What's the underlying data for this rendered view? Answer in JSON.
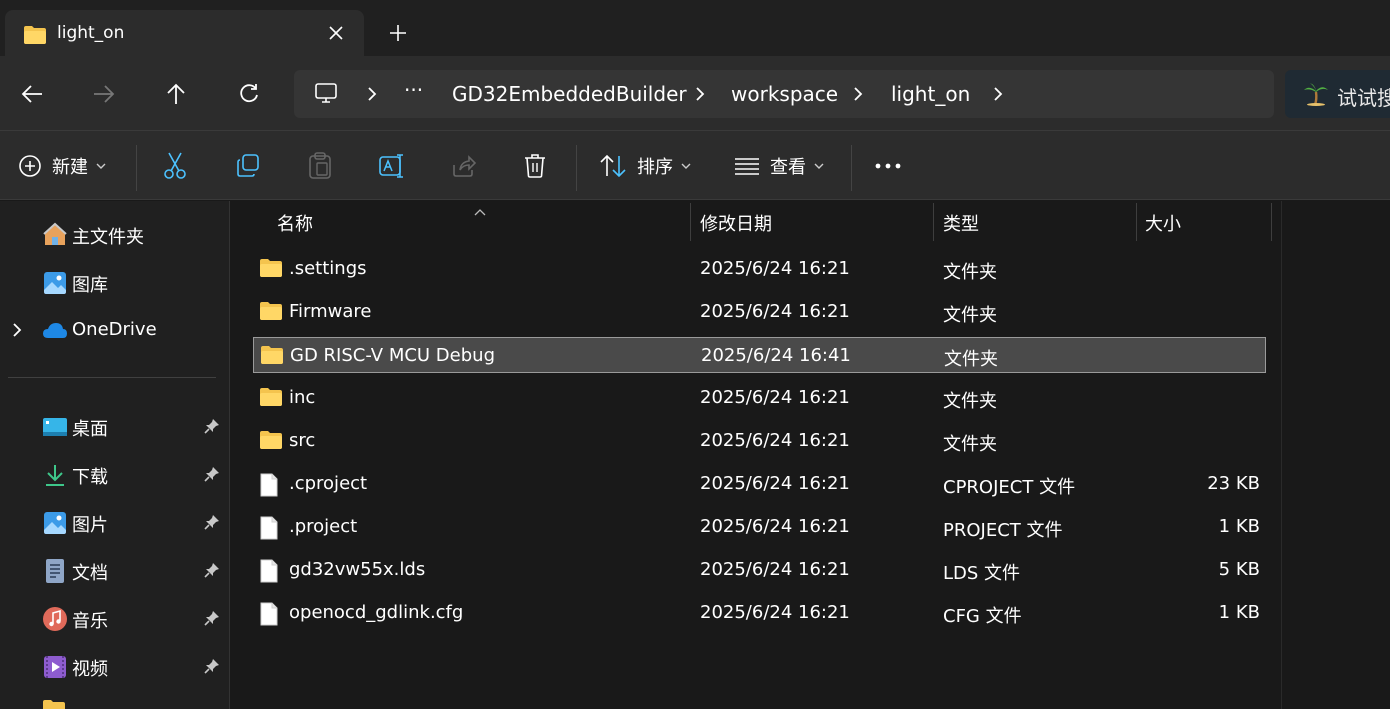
{
  "window": {
    "tab_title": "light_on"
  },
  "breadcrumb": {
    "overflow": "···",
    "items": [
      "GD32EmbeddedBuilder",
      "workspace",
      "light_on"
    ]
  },
  "search": {
    "placeholder": "试试搜"
  },
  "toolbar": {
    "new_label": "新建",
    "sort_label": "排序",
    "view_label": "查看",
    "more_label": "···"
  },
  "sidebar": {
    "items": [
      {
        "label": "主文件夹",
        "icon": "home-icon"
      },
      {
        "label": "图库",
        "icon": "gallery-icon"
      },
      {
        "label": "OneDrive",
        "icon": "cloud-icon"
      }
    ],
    "pinned": [
      {
        "label": "桌面",
        "icon": "desktop-icon"
      },
      {
        "label": "下载",
        "icon": "download-icon"
      },
      {
        "label": "图片",
        "icon": "pictures-icon"
      },
      {
        "label": "文档",
        "icon": "documents-icon"
      },
      {
        "label": "音乐",
        "icon": "music-icon"
      },
      {
        "label": "视频",
        "icon": "videos-icon"
      }
    ]
  },
  "columns": {
    "name": "名称",
    "date": "修改日期",
    "type": "类型",
    "size": "大小"
  },
  "files": [
    {
      "name": ".settings",
      "date": "2025/6/24 16:21",
      "type": "文件夹",
      "size": "",
      "kind": "folder"
    },
    {
      "name": "Firmware",
      "date": "2025/6/24 16:21",
      "type": "文件夹",
      "size": "",
      "kind": "folder"
    },
    {
      "name": "GD RISC-V MCU Debug",
      "date": "2025/6/24 16:41",
      "type": "文件夹",
      "size": "",
      "kind": "folder",
      "selected": true
    },
    {
      "name": "inc",
      "date": "2025/6/24 16:21",
      "type": "文件夹",
      "size": "",
      "kind": "folder"
    },
    {
      "name": "src",
      "date": "2025/6/24 16:21",
      "type": "文件夹",
      "size": "",
      "kind": "folder"
    },
    {
      "name": ".cproject",
      "date": "2025/6/24 16:21",
      "type": "CPROJECT 文件",
      "size": "23 KB",
      "kind": "file"
    },
    {
      "name": ".project",
      "date": "2025/6/24 16:21",
      "type": "PROJECT 文件",
      "size": "1 KB",
      "kind": "file"
    },
    {
      "name": "gd32vw55x.lds",
      "date": "2025/6/24 16:21",
      "type": "LDS 文件",
      "size": "5 KB",
      "kind": "file"
    },
    {
      "name": "openocd_gdlink.cfg",
      "date": "2025/6/24 16:21",
      "type": "CFG 文件",
      "size": "1 KB",
      "kind": "file"
    }
  ],
  "colors": {
    "folder": "#f4c44e",
    "accent": "#4cc2ff"
  }
}
